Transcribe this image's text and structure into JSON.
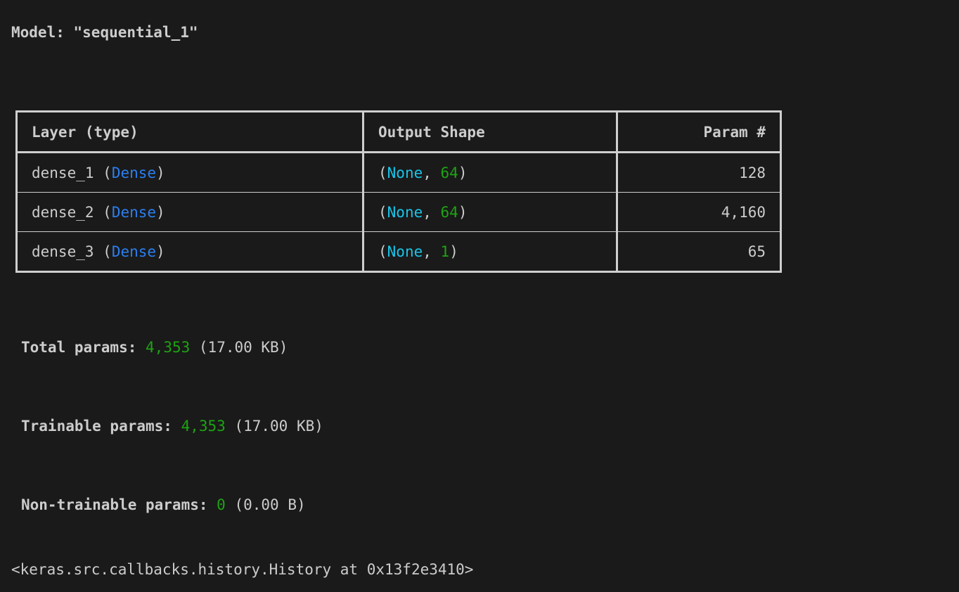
{
  "model": {
    "prefix": "Model: ",
    "name": "\"sequential_1\""
  },
  "table": {
    "headers": {
      "layer": "Layer (type)",
      "output_shape": "Output Shape",
      "params": "Param #"
    },
    "rows": [
      {
        "name": "dense_1",
        "type": "Dense",
        "shape_none": "None",
        "shape_dim": "64",
        "params": "128"
      },
      {
        "name": "dense_2",
        "type": "Dense",
        "shape_none": "None",
        "shape_dim": "64",
        "params": "4,160"
      },
      {
        "name": "dense_3",
        "type": "Dense",
        "shape_none": "None",
        "shape_dim": "1",
        "params": "65"
      }
    ]
  },
  "summary": {
    "total": {
      "label": "Total params:",
      "count": "4,353",
      "size": "(17.00 KB)"
    },
    "trainable": {
      "label": "Trainable params:",
      "count": "4,353",
      "size": "(17.00 KB)"
    },
    "non_trainable": {
      "label": "Non-trainable params:",
      "count": "0",
      "size": "(0.00 B)"
    }
  },
  "output": {
    "history_repr": "<keras.src.callbacks.history.History at 0x13f2e3410>"
  },
  "colors": {
    "background": "#1a1a1a",
    "text": "#cccccc",
    "number": "#1ea313",
    "class_name": "#2a7ff0",
    "none_keyword": "#19c4e8",
    "border": "#cfcfcf"
  }
}
